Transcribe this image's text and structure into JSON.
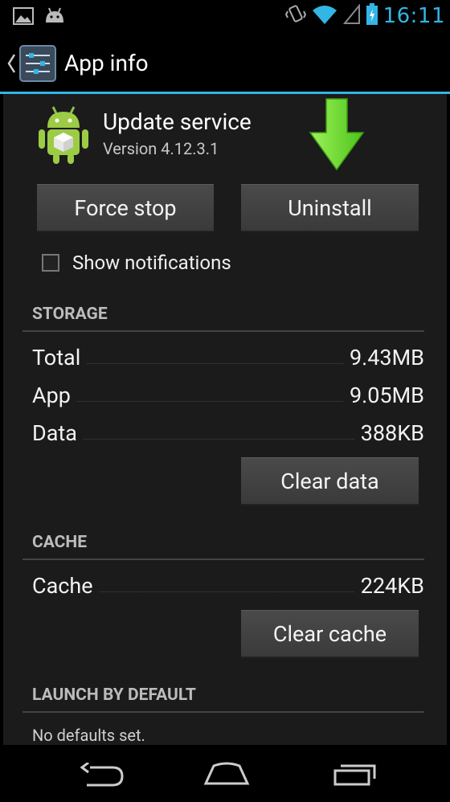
{
  "status_bar": {
    "time": "16:11",
    "left_icons": [
      "image-icon",
      "android-icon"
    ],
    "right_icons": [
      "vibrate-icon",
      "wifi-icon",
      "signal-icon",
      "battery-icon"
    ],
    "accent_color": "#33b5e5"
  },
  "action_bar": {
    "title": "App info",
    "icon": "settings-sliders-icon"
  },
  "app": {
    "name": "Update service",
    "version": "Version 4.12.3.1",
    "icon": "android-robot-icon"
  },
  "buttons": {
    "force_stop": "Force stop",
    "uninstall": "Uninstall",
    "clear_data": "Clear data",
    "clear_cache": "Clear cache"
  },
  "show_notifications": {
    "label": "Show notifications",
    "checked": false
  },
  "storage": {
    "header": "STORAGE",
    "rows": [
      {
        "label": "Total",
        "value": "9.43MB"
      },
      {
        "label": "App",
        "value": "9.05MB"
      },
      {
        "label": "Data",
        "value": "388KB"
      }
    ]
  },
  "cache": {
    "header": "CACHE",
    "rows": [
      {
        "label": "Cache",
        "value": "224KB"
      }
    ]
  },
  "launch_by_default": {
    "header": "LAUNCH BY DEFAULT",
    "text": "No defaults set."
  },
  "nav_bar": {
    "icons": [
      "back-icon",
      "home-icon",
      "recent-apps-icon"
    ]
  }
}
